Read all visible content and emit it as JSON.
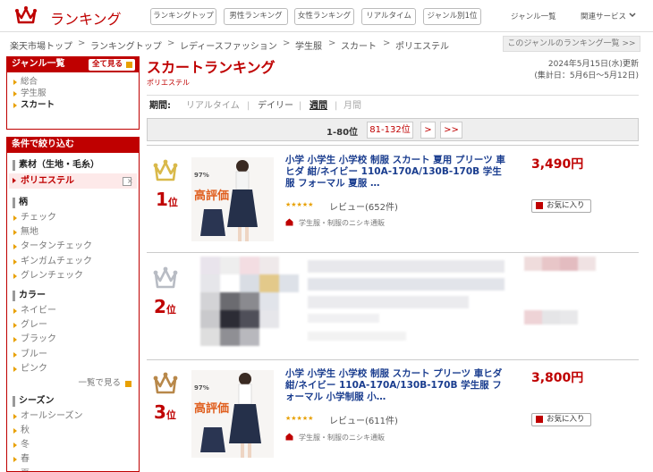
{
  "header": {
    "logo_text": "ランキング",
    "nav_buttons": [
      "ランキングトップ",
      "男性ランキング",
      "女性ランキング",
      "リアルタイム",
      "ジャンル別1位"
    ],
    "genre_list": "ジャンル一覧",
    "related_services": "関連サービス"
  },
  "breadcrumb": [
    "楽天市場トップ",
    "ランキングトップ",
    "レディースファッション",
    "学生服",
    "スカート",
    "ポリエステル"
  ],
  "breadcrumb_sep": ">",
  "genre_ranking_list_link": "このジャンルのランキング一覧 >>",
  "sidebar": {
    "genre_head": "ジャンル一覧",
    "see_all": "全て見る",
    "genre_links": [
      "総合",
      "学生服",
      "スカート"
    ],
    "filter_head": "条件で絞り込む",
    "material_label": "素材（生地・毛糸）",
    "material_selected": "ポリエステル",
    "pattern_label": "柄",
    "patterns": [
      "チェック",
      "無地",
      "タータンチェック",
      "ギンガムチェック",
      "グレンチェック"
    ],
    "color_label": "カラー",
    "colors": [
      "ネイビー",
      "グレー",
      "ブラック",
      "ブルー",
      "ピンク"
    ],
    "more_link": "一覧で見る",
    "season_label": "シーズン",
    "seasons": [
      "オールシーズン",
      "秋",
      "冬",
      "春",
      "夏"
    ]
  },
  "main": {
    "title": "スカートランキング",
    "subgenre": "ポリエステル",
    "updated_line1": "2024年5月15日(水)更新",
    "updated_line2": "(集計日：5月6日～5月12日)",
    "period_label": "期間:",
    "periods": [
      "リアルタイム",
      "デイリー",
      "週間",
      "月間"
    ],
    "period_sep": "|",
    "pager": {
      "current": "1-80位",
      "next_range": "81-132位",
      "next": ">",
      "last": ">>"
    }
  },
  "items": [
    {
      "rank": "1",
      "rank_suffix": "位",
      "title": "小学 小学生 小学校 制服 スカート 夏用 プリーツ 車ヒダ 紺/ネイビー 110A-170A/130B-170B 学生服 フォーマル 夏服 …",
      "stars": "★★★★★",
      "review": "レビュー(652件)",
      "shop": "学生服・制服のニシキ通販",
      "price": "3,490円",
      "fav": "お気に入り",
      "badge_pct": "97%",
      "badge_text": "高評価",
      "crown_color": "#d9b94a"
    },
    {
      "rank": "2",
      "rank_suffix": "位",
      "crown_color": "#b8bcc4"
    },
    {
      "rank": "3",
      "rank_suffix": "位",
      "title": "小学 小学生 小学校 制服 スカート プリーツ 車ヒダ 紺/ネイビー 110A-170A/130B-170B 学生服 フォーマル 小学制服 小…",
      "stars": "★★★★★",
      "review": "レビュー(611件)",
      "shop": "学生服・制服のニシキ通販",
      "price": "3,800円",
      "fav": "お気に入り",
      "badge_pct": "97%",
      "badge_text": "高評価",
      "crown_color": "#b8884a"
    }
  ]
}
